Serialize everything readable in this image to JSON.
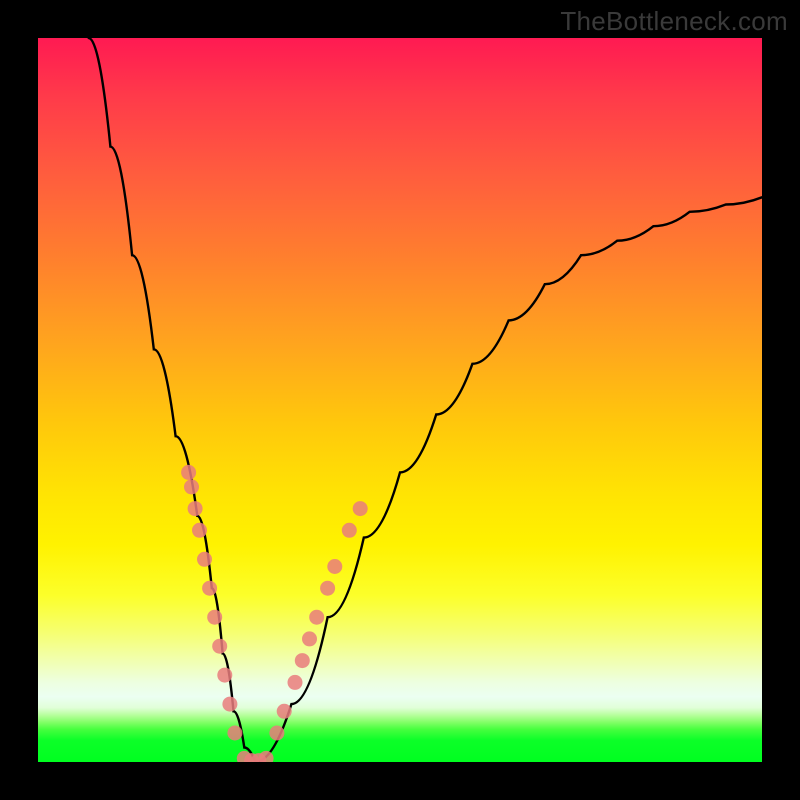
{
  "watermark": "TheBottleneck.com",
  "chart_data": {
    "type": "line",
    "title": "",
    "xlabel": "",
    "ylabel": "",
    "xlim": [
      0,
      100
    ],
    "ylim": [
      0,
      100
    ],
    "grid": false,
    "series": [
      {
        "name": "bottleneck-curve",
        "x": [
          7,
          10,
          13,
          16,
          19,
          22,
          24,
          25.5,
          27,
          28.5,
          30,
          35,
          40,
          45,
          50,
          55,
          60,
          65,
          70,
          75,
          80,
          85,
          90,
          95,
          100
        ],
        "y": [
          100,
          85,
          70,
          57,
          45,
          34,
          24,
          15,
          7,
          2,
          0,
          8,
          20,
          31,
          40,
          48,
          55,
          61,
          66,
          70,
          72,
          74,
          76,
          77,
          78
        ]
      }
    ],
    "markers": [
      {
        "name": "left-branch-marker",
        "x": 20.8,
        "y_approx": 40
      },
      {
        "name": "left-branch-marker",
        "x": 21.2,
        "y_approx": 38
      },
      {
        "name": "left-branch-marker",
        "x": 21.7,
        "y_approx": 35
      },
      {
        "name": "left-branch-marker",
        "x": 22.3,
        "y_approx": 32
      },
      {
        "name": "left-branch-marker",
        "x": 23.0,
        "y_approx": 28
      },
      {
        "name": "left-branch-marker",
        "x": 23.7,
        "y_approx": 24
      },
      {
        "name": "left-branch-marker",
        "x": 24.4,
        "y_approx": 20
      },
      {
        "name": "left-branch-marker",
        "x": 25.1,
        "y_approx": 16
      },
      {
        "name": "left-branch-marker",
        "x": 25.8,
        "y_approx": 12
      },
      {
        "name": "left-branch-marker",
        "x": 26.5,
        "y_approx": 8
      },
      {
        "name": "left-branch-marker",
        "x": 27.2,
        "y_approx": 4
      },
      {
        "name": "valley-marker",
        "x": 28.5,
        "y_approx": 0.5
      },
      {
        "name": "valley-marker",
        "x": 29.5,
        "y_approx": 0.2
      },
      {
        "name": "valley-marker",
        "x": 30.5,
        "y_approx": 0.2
      },
      {
        "name": "valley-marker",
        "x": 31.5,
        "y_approx": 0.5
      },
      {
        "name": "right-branch-marker",
        "x": 33.0,
        "y_approx": 4
      },
      {
        "name": "right-branch-marker",
        "x": 34.0,
        "y_approx": 7
      },
      {
        "name": "right-branch-marker",
        "x": 35.5,
        "y_approx": 11
      },
      {
        "name": "right-branch-marker",
        "x": 36.5,
        "y_approx": 14
      },
      {
        "name": "right-branch-marker",
        "x": 37.5,
        "y_approx": 17
      },
      {
        "name": "right-branch-marker",
        "x": 38.5,
        "y_approx": 20
      },
      {
        "name": "right-branch-marker",
        "x": 40.0,
        "y_approx": 24
      },
      {
        "name": "right-branch-marker",
        "x": 41.0,
        "y_approx": 27
      },
      {
        "name": "right-branch-marker",
        "x": 43.0,
        "y_approx": 32
      },
      {
        "name": "right-branch-marker",
        "x": 44.5,
        "y_approx": 35
      }
    ]
  },
  "colors": {
    "curve": "#000000",
    "marker": "#e97c7c",
    "background_frame": "#000000"
  }
}
